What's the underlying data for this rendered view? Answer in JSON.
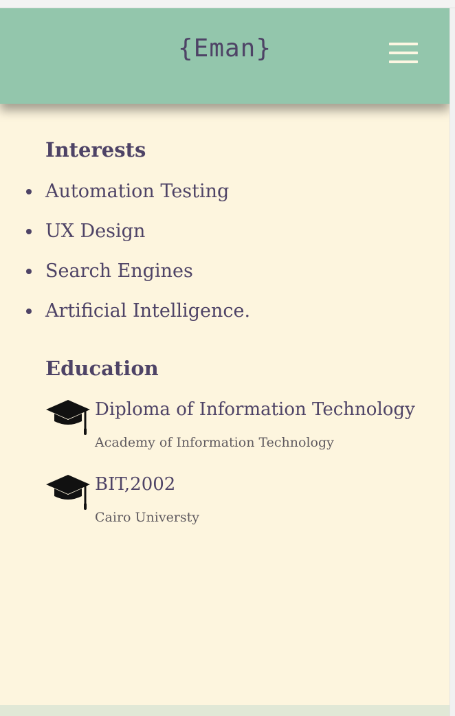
{
  "header": {
    "logo": "{Eman}",
    "menu_icon": "hamburger-menu-icon"
  },
  "interests": {
    "title": "Interests",
    "items": [
      "Automation Testing",
      "UX Design",
      "Search Engines",
      "Artificial Intelligence."
    ]
  },
  "education": {
    "title": "Education",
    "icon": "graduation-cap-icon",
    "entries": [
      {
        "degree": "Diploma of Information Technology",
        "school": "Academy of Information Technology"
      },
      {
        "degree": "BIT,2002",
        "school": "Cairo Universty"
      }
    ]
  },
  "colors": {
    "navbar": "#93c6ac",
    "background": "#fdf5de",
    "text": "#4e4366",
    "footer": "#e1e8d6"
  }
}
